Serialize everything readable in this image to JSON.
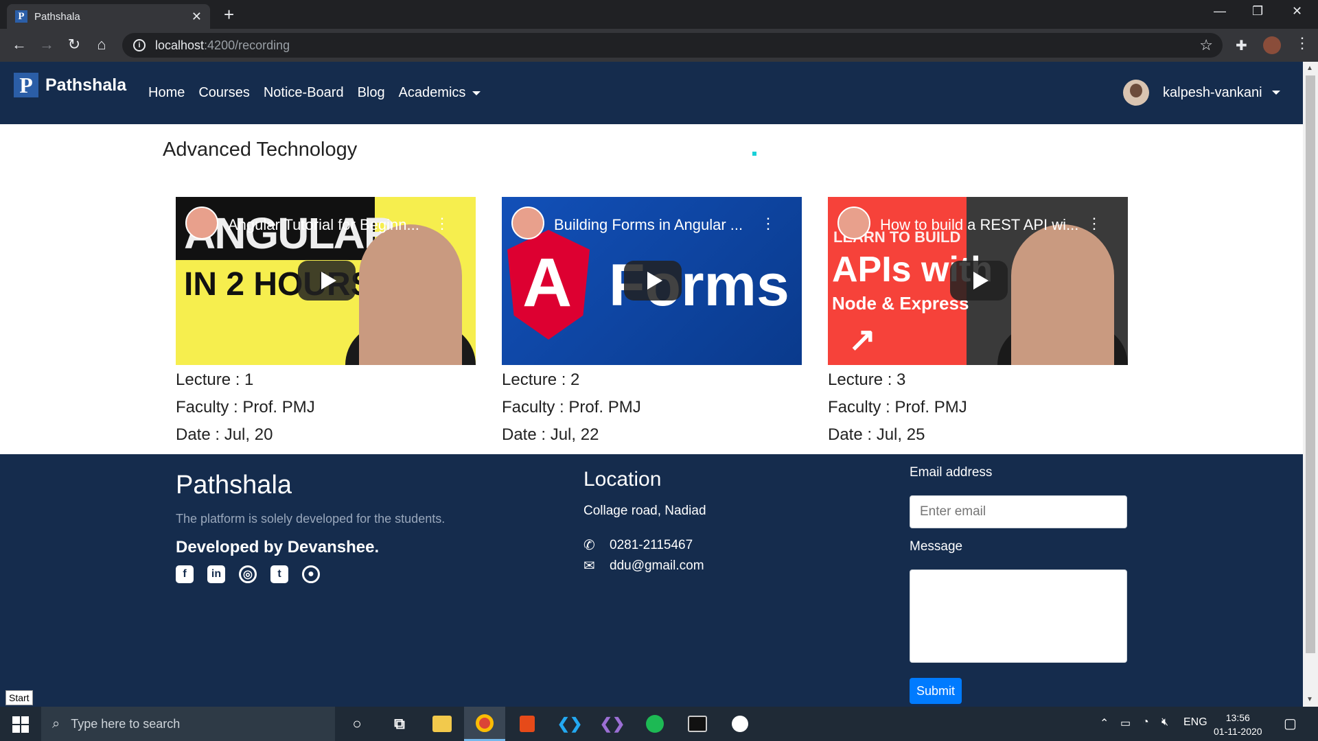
{
  "browser": {
    "tab_title": "Pathshala",
    "tab_favicon": "P",
    "url_host": "localhost",
    "url_path": ":4200/recording"
  },
  "nav": {
    "brand_logo": "P",
    "brand_name": "Pathshala",
    "links": [
      "Home",
      "Courses",
      "Notice-Board",
      "Blog",
      "Academics"
    ],
    "user_name": "kalpesh-vankani"
  },
  "main": {
    "heading": "Advanced Technology",
    "videos": [
      {
        "title": "Angular Tutorial for Beginn...",
        "thumb_line1": "ANGULAR",
        "thumb_line2": "IN 2 HOURS",
        "lecture": "Lecture : 1",
        "faculty": "Faculty : Prof. PMJ",
        "date": "Date : Jul, 20"
      },
      {
        "title": "Building Forms in Angular ...",
        "thumb_line1": "A",
        "thumb_line2": "Forms",
        "lecture": "Lecture : 2",
        "faculty": "Faculty : Prof. PMJ",
        "date": "Date : Jul, 22"
      },
      {
        "title": "How to build a REST API wi...",
        "thumb_line1": "LEARN TO BUILD",
        "thumb_line2": "APIs with",
        "thumb_line3": "Node & Express",
        "lecture": "Lecture : 3",
        "faculty": "Faculty : Prof. PMJ",
        "date": "Date : Jul, 25"
      }
    ]
  },
  "footer": {
    "brand": "Pathshala",
    "tagline": "The platform is solely developed for the students.",
    "developed_by": "Developed by Devanshee.",
    "socials": [
      "facebook-icon",
      "linkedin-icon",
      "instagram-icon",
      "twitter-icon",
      "github-icon"
    ],
    "location_heading": "Location",
    "address": "Collage road, Nadiad",
    "phone": "0281-2115467",
    "email": "ddu@gmail.com",
    "form": {
      "email_label": "Email address",
      "email_placeholder": "Enter email",
      "message_label": "Message",
      "submit_label": "Submit"
    }
  },
  "taskbar": {
    "start_tooltip": "Start",
    "search_placeholder": "Type here to search",
    "language": "ENG",
    "time": "13:56",
    "date": "01-11-2020"
  },
  "colors": {
    "navbar": "#152c4d",
    "primary_button": "#007bff"
  }
}
